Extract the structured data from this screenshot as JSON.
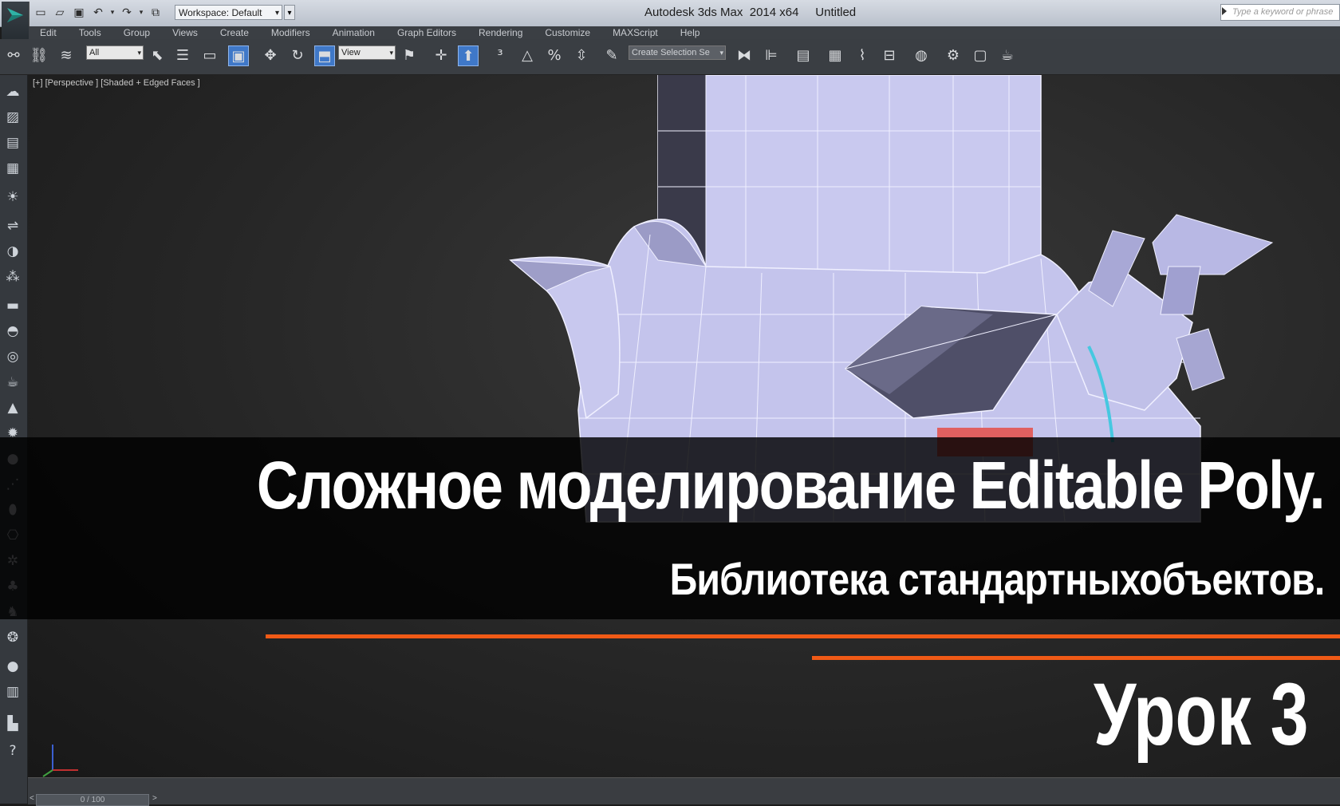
{
  "window": {
    "title": "Autodesk 3ds Max  2014 x64     Untitled",
    "workspace": "Workspace: Default",
    "search_placeholder": "Type a keyword or phrase"
  },
  "menu": [
    "Edit",
    "Tools",
    "Group",
    "Views",
    "Create",
    "Modifiers",
    "Animation",
    "Graph Editors",
    "Rendering",
    "Customize",
    "MAXScript",
    "Help"
  ],
  "toolbar": {
    "filter_value": "All",
    "coord_value": "View",
    "selection_set_placeholder": "Create Selection Se"
  },
  "viewport": {
    "label": "[+] [Perspective ] [Shaded + Edged Faces ]"
  },
  "overlay": {
    "title": "Сложное моделирование Editable Poly.",
    "subtitle": "Библиотека стандартныхобъектов.",
    "lesson": "Урок 3",
    "accent_color": "#f05a16"
  },
  "timeline": {
    "frame": "0 / 100"
  },
  "colors": {
    "model_face": "#c6c6ee",
    "model_dark": "#5a5a72",
    "selection_edge": "#46c8e0",
    "selected_face": "#e06060"
  }
}
